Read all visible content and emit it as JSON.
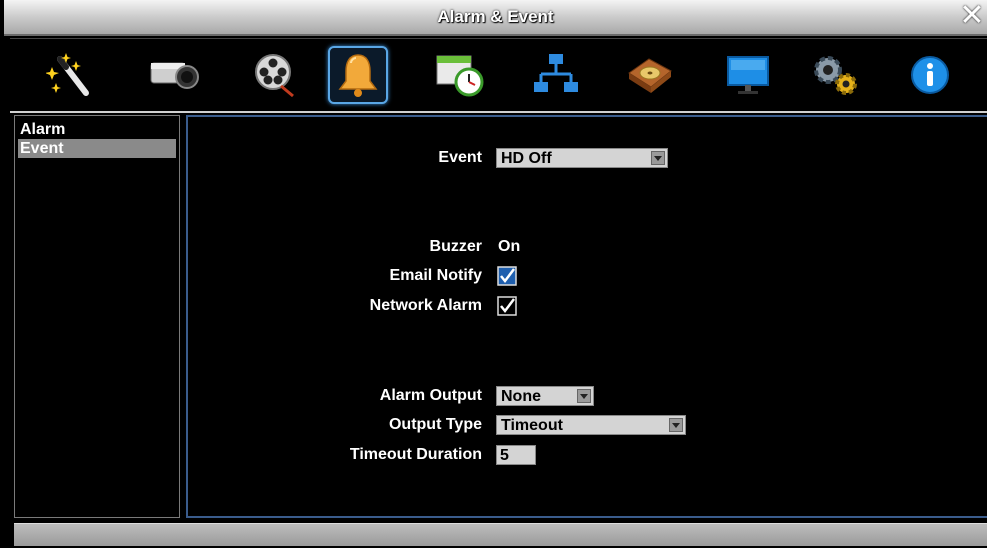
{
  "window": {
    "title": "Alarm & Event",
    "close_glyph": "✕"
  },
  "toolbar": {
    "items": [
      {
        "icon": "magic-wand-icon"
      },
      {
        "icon": "camera-icon"
      },
      {
        "icon": "film-reel-icon"
      },
      {
        "icon": "bell-icon",
        "active": true
      },
      {
        "icon": "schedule-clock-icon"
      },
      {
        "icon": "network-icon"
      },
      {
        "icon": "hard-disk-icon"
      },
      {
        "icon": "monitor-icon"
      },
      {
        "icon": "gears-icon"
      },
      {
        "icon": "info-icon"
      }
    ]
  },
  "sidebar": {
    "items": [
      {
        "label": "Alarm"
      },
      {
        "label": "Event",
        "selected": true
      }
    ]
  },
  "form": {
    "event": {
      "label": "Event",
      "value": "HD Off"
    },
    "buzzer": {
      "label": "Buzzer",
      "value": "On"
    },
    "email_notify": {
      "label": "Email Notify",
      "checked": true
    },
    "network_alarm": {
      "label": "Network Alarm",
      "checked": true
    },
    "alarm_output": {
      "label": "Alarm Output",
      "value": "None"
    },
    "output_type": {
      "label": "Output Type",
      "value": "Timeout"
    },
    "timeout_duration": {
      "label": "Timeout Duration",
      "value": "5"
    }
  },
  "colors": {
    "accent": "#3a5c8c",
    "active_border": "#5aa7e6",
    "selected_row": "#8a8a8a"
  }
}
